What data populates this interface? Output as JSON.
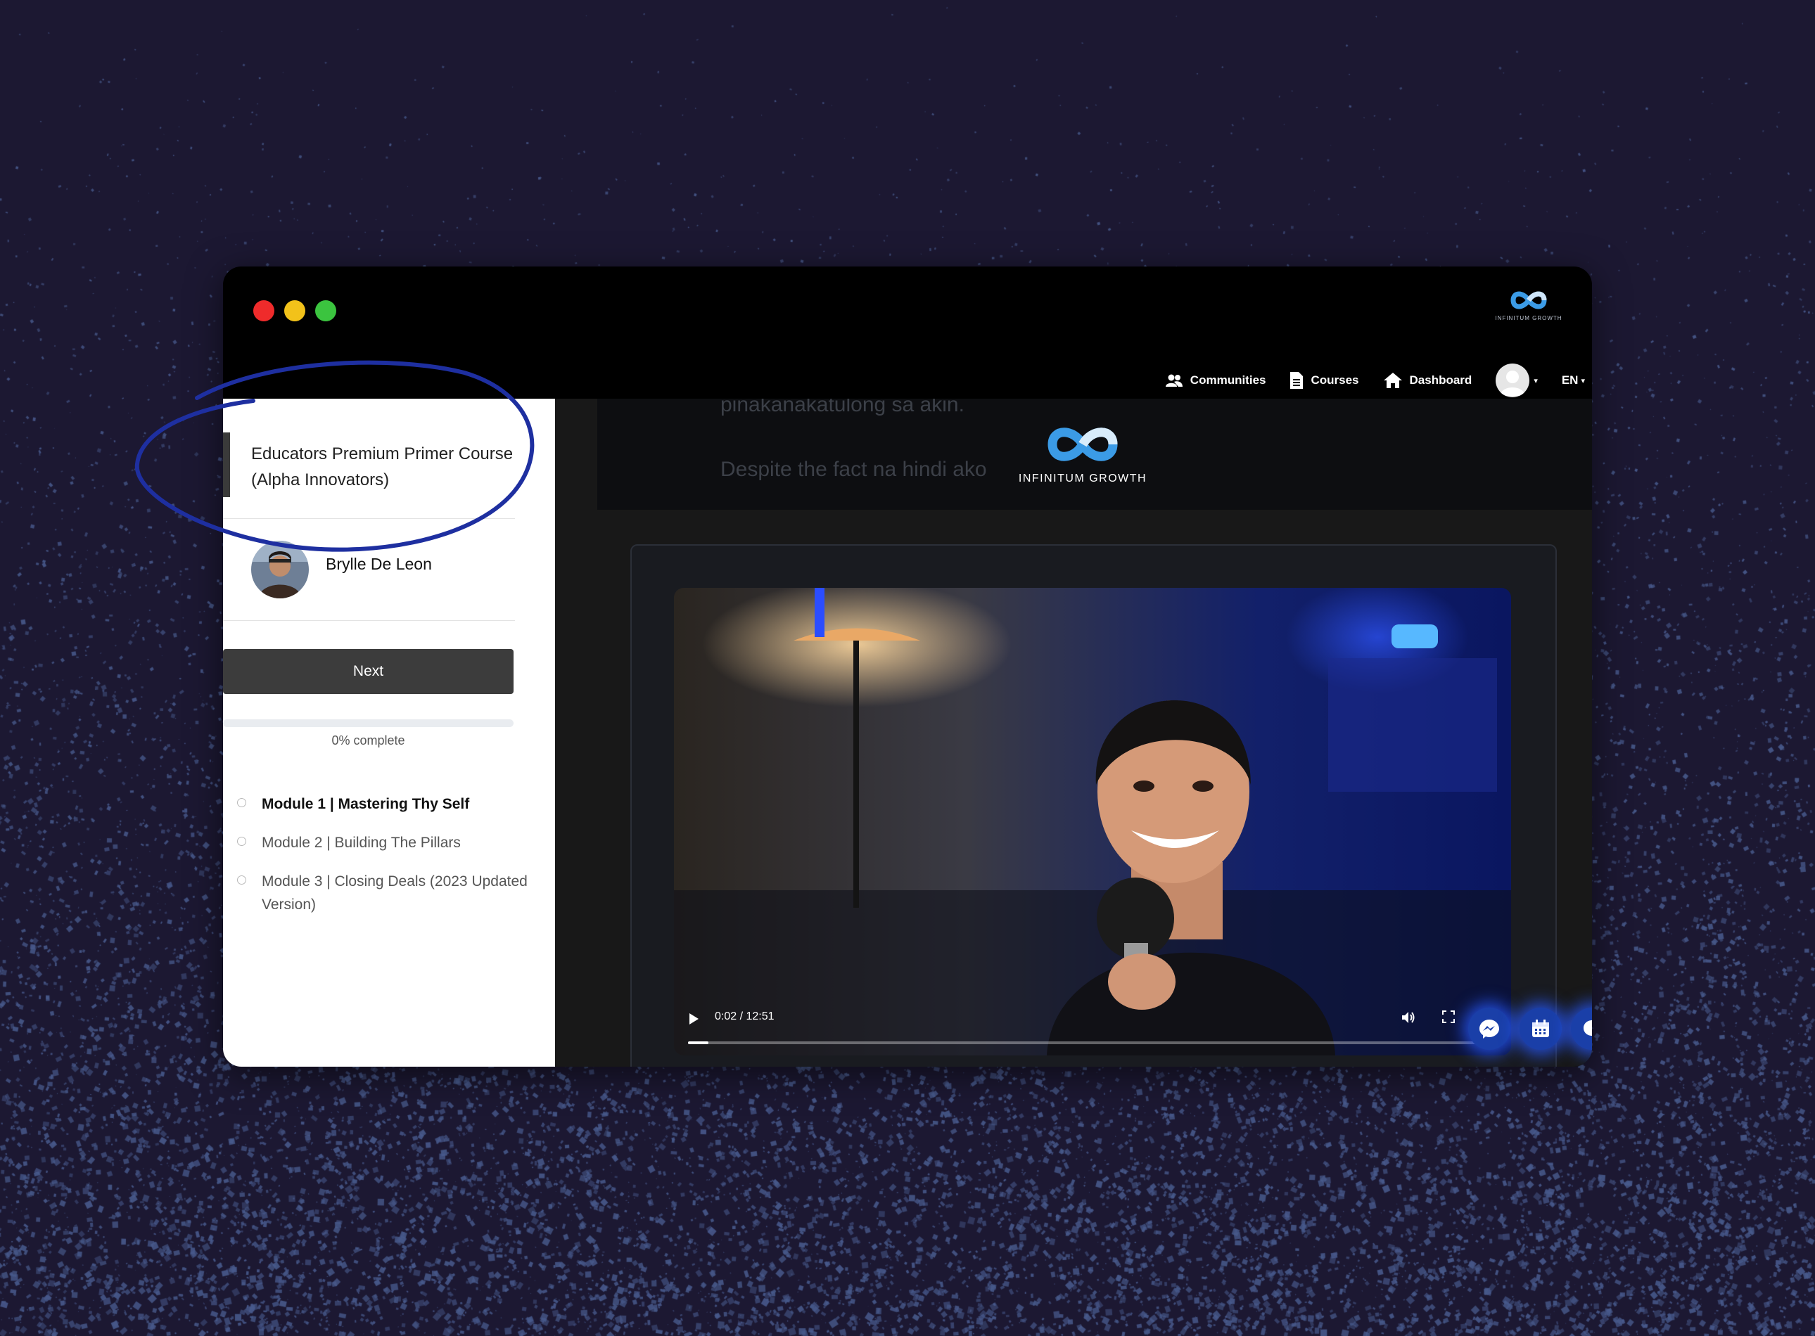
{
  "window": {
    "brand_caption": "INFINITUM GROWTH"
  },
  "nav": {
    "communities": "Communities",
    "courses": "Courses",
    "dashboard": "Dashboard",
    "language": "EN"
  },
  "sidebar": {
    "course_title": "Educators Premium Primer Course (Alpha Innovators)",
    "instructor": "Brylle De Leon",
    "next_label": "Next",
    "progress_percent": 0,
    "progress_label": "0% complete",
    "modules": [
      {
        "label": "Module 1 | Mastering Thy Self",
        "active": true
      },
      {
        "label": "Module 2 | Building The Pillars",
        "active": false
      },
      {
        "label": "Module 3 | Closing Deals (2023 Updated Version)",
        "active": false
      }
    ]
  },
  "banner": {
    "ghost_line1": "pinakanakatulong sa akin.",
    "ghost_line2": "Despite the fact na hindi ako",
    "logo_caption": "INFINITUM GROWTH"
  },
  "video": {
    "time_label": "0:02 / 12:51",
    "progress_fraction": 0.0026
  },
  "floating_buttons": [
    "messenger-icon",
    "calendar-icon",
    "chat-icon"
  ],
  "colors": {
    "page_bg": "#1c1832",
    "speckle": "#3d4a78",
    "annotation_circle": "#1e2fa0",
    "fab_glow": "#2a5cff"
  }
}
